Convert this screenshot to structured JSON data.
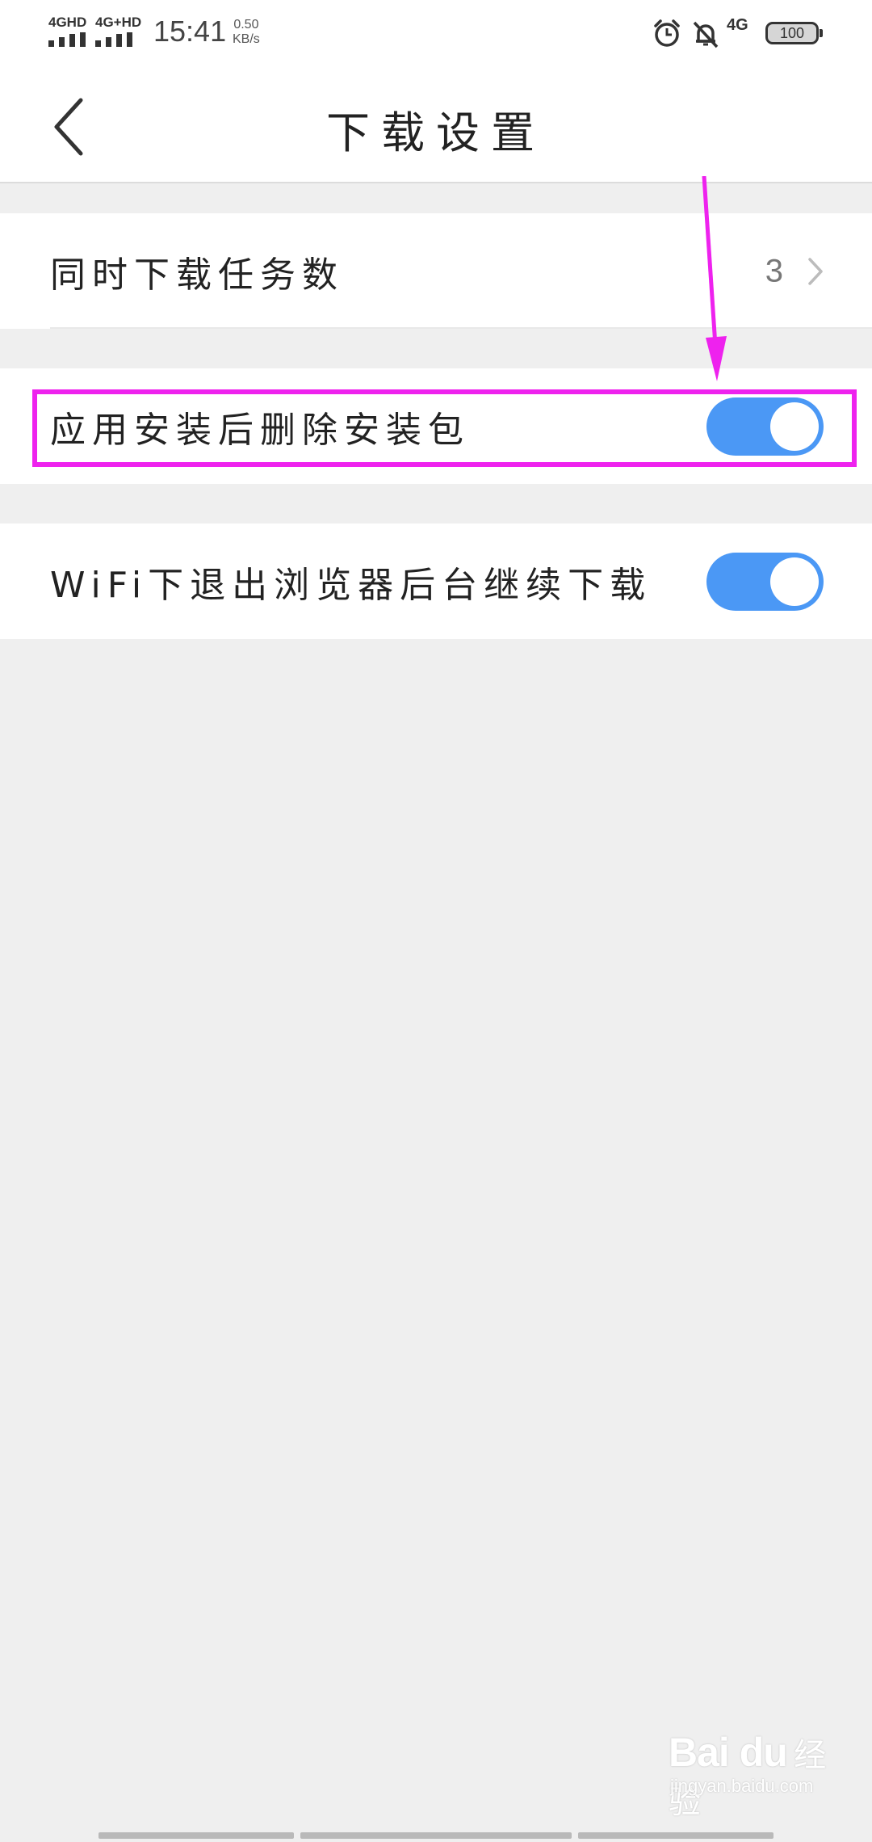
{
  "status_bar": {
    "sim1": "4GHD",
    "sim2": "4G+HD",
    "time": "15:41",
    "speed_value": "0.50",
    "speed_unit": "KB/s",
    "net": "4G",
    "battery": "100"
  },
  "header": {
    "title": "下载设置",
    "back_icon": "chevron-left-icon"
  },
  "settings": {
    "concurrent_tasks": {
      "label": "同时下载任务数",
      "value": "3"
    },
    "delete_package": {
      "label": "应用安装后删除安装包",
      "enabled": true
    },
    "wifi_background": {
      "label": "WiFi下退出浏览器后台继续下载",
      "enabled": true
    }
  },
  "annotation": {
    "color": "#ee22ee"
  },
  "toggle_color": "#4b98f5",
  "watermark": {
    "logo": "Bai du",
    "cn": "经验",
    "url": "jingyan.baidu.com"
  }
}
